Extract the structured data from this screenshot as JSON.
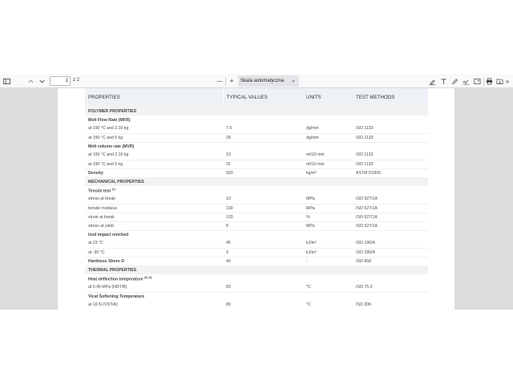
{
  "toolbar": {
    "page_value": "1",
    "page_total": "z 2",
    "zoom_minus": "—",
    "zoom_plus": "+",
    "zoom_label": "Skala automatyczna",
    "more": "»"
  },
  "table": {
    "headers": [
      "PROPERTIES",
      "TYPICAL VALUES",
      "UNITS",
      "TEST METHODS"
    ],
    "rows": [
      {
        "type": "section",
        "cells": [
          "POLYMER PROPERTIES",
          "",
          "",
          ""
        ]
      },
      {
        "type": "bold",
        "cells": [
          "Melt Flow Rate (MFR)",
          "",
          "",
          ""
        ]
      },
      {
        "type": "row",
        "cells": [
          "at 190 °C and 2.16 kg",
          "7.5",
          "dg/min",
          "ISO 1133"
        ]
      },
      {
        "type": "row",
        "cells": [
          "at 190 °C and 5 kg",
          "28",
          "dg/min",
          "ISO 1133"
        ]
      },
      {
        "type": "bold",
        "cells": [
          "Melt volume rate (MVR)",
          "",
          "",
          ""
        ]
      },
      {
        "type": "row",
        "cells": [
          "at 190 °C and 2.16 kg",
          "10",
          "ml/10 min",
          "ISO 1133"
        ]
      },
      {
        "type": "row",
        "cells": [
          "at 190 °C and 5 kg",
          "31",
          "ml/10 min",
          "ISO 1133"
        ]
      },
      {
        "type": "bold",
        "cells": [
          "Density",
          "920",
          "kg/m³",
          "ASTM D1505"
        ]
      },
      {
        "type": "section",
        "cells": [
          "MECHANICAL PROPERTIES",
          "",
          "",
          ""
        ]
      },
      {
        "type": "bold",
        "cells": [
          "Tensile test",
          "",
          "",
          ""
        ],
        "sup": "(1)"
      },
      {
        "type": "row",
        "cells": [
          "stress at break",
          "10",
          "MPa",
          "ISO 527/1A"
        ]
      },
      {
        "type": "row",
        "cells": [
          "tensile modulus",
          "130",
          "MPa",
          "ISO 527/1A"
        ]
      },
      {
        "type": "row",
        "cells": [
          "strain at break",
          "120",
          "%",
          "ISO 527/1A"
        ]
      },
      {
        "type": "row",
        "cells": [
          "stress at yield",
          "8",
          "MPa",
          "ISO 527/1A"
        ]
      },
      {
        "type": "bold",
        "cells": [
          "Izod impact notched",
          "",
          "",
          ""
        ]
      },
      {
        "type": "row",
        "cells": [
          "at 23 °C",
          "45",
          "kJ/m²",
          "ISO 180/A"
        ]
      },
      {
        "type": "row",
        "cells": [
          "at -30 °C",
          "9",
          "kJ/m²",
          "ISO 180/A"
        ]
      },
      {
        "type": "bold",
        "cells": [
          "Hardness Shore D",
          "40",
          "-",
          "ISO 868"
        ]
      },
      {
        "type": "section",
        "cells": [
          "THERMAL PROPERTIES",
          "",
          "",
          ""
        ]
      },
      {
        "type": "bold",
        "cells": [
          "Heat deflection temperature",
          "",
          "",
          ""
        ],
        "sup": "(2) (3)"
      },
      {
        "type": "row",
        "cells": [
          "at 0.45 MPa (HDT/B)",
          "83",
          "°C",
          "ISO 75-2"
        ]
      },
      {
        "type": "bold",
        "cells": [
          "Vicat Softening Temperature",
          "",
          "",
          ""
        ]
      },
      {
        "type": "row",
        "cells": [
          "at 10 N (VST/A)",
          "89",
          "°C",
          "ISO 306"
        ]
      }
    ]
  },
  "icons": [
    "sidebar-toggle-icon",
    "chevron-up-icon",
    "chevron-down-icon",
    "highlight-icon",
    "text-icon",
    "draw-icon",
    "signature-icon",
    "image-icon",
    "print-icon",
    "save-icon",
    "copy-icon"
  ]
}
